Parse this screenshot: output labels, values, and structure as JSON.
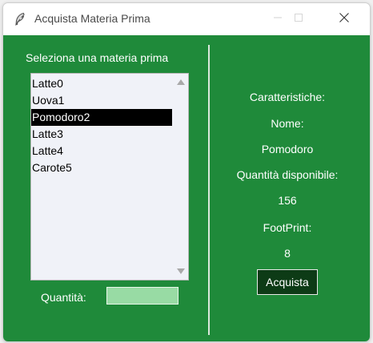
{
  "window": {
    "title": "Acquista Materia Prima",
    "icon": "feather-icon",
    "controls": [
      "minimize-icon",
      "maximize-icon",
      "close-icon"
    ]
  },
  "colors": {
    "background": "#1f8a3a",
    "selected_item_bg": "#000000",
    "button_bg": "#0d3b16",
    "quantity_field_bg": "#98dba4"
  },
  "left": {
    "heading": "Seleziona una materia prima",
    "items": [
      {
        "label": "Latte0",
        "selected": false
      },
      {
        "label": "Uova1",
        "selected": false
      },
      {
        "label": "Pomodoro2",
        "selected": true
      },
      {
        "label": "Latte3",
        "selected": false
      },
      {
        "label": "Latte4",
        "selected": false
      },
      {
        "label": "Carote5",
        "selected": false
      }
    ],
    "quantity_label": "Quantità:",
    "quantity_value": ""
  },
  "right": {
    "heading": "Caratteristiche:",
    "name_label": "Nome:",
    "name_value": "Pomodoro",
    "available_label": "Quantità disponibile:",
    "available_value": "156",
    "footprint_label": "FootPrint:",
    "footprint_value": "8",
    "buy_button": "Acquista"
  }
}
